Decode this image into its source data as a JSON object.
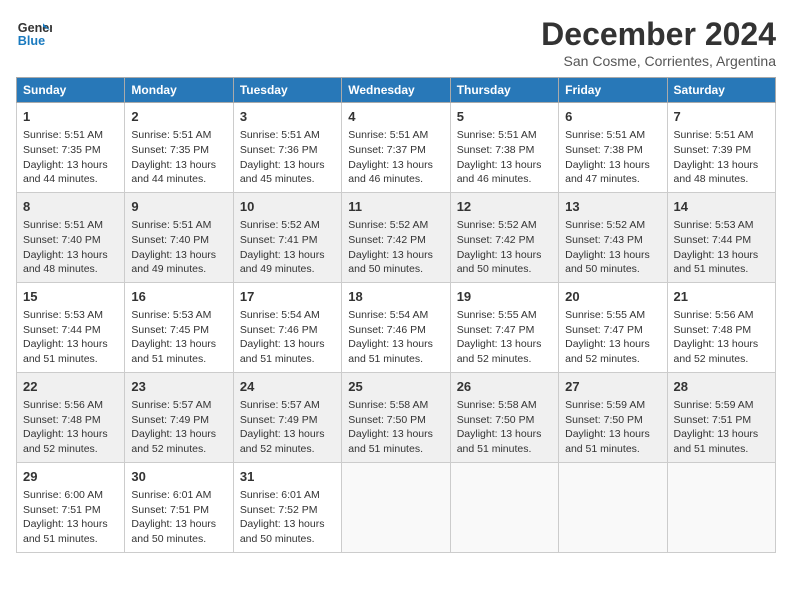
{
  "header": {
    "logo_line1": "General",
    "logo_line2": "Blue",
    "month": "December 2024",
    "location": "San Cosme, Corrientes, Argentina"
  },
  "weekdays": [
    "Sunday",
    "Monday",
    "Tuesday",
    "Wednesday",
    "Thursday",
    "Friday",
    "Saturday"
  ],
  "weeks": [
    [
      {
        "day": 1,
        "lines": [
          "Sunrise: 5:51 AM",
          "Sunset: 7:35 PM",
          "Daylight: 13 hours",
          "and 44 minutes."
        ]
      },
      {
        "day": 2,
        "lines": [
          "Sunrise: 5:51 AM",
          "Sunset: 7:35 PM",
          "Daylight: 13 hours",
          "and 44 minutes."
        ]
      },
      {
        "day": 3,
        "lines": [
          "Sunrise: 5:51 AM",
          "Sunset: 7:36 PM",
          "Daylight: 13 hours",
          "and 45 minutes."
        ]
      },
      {
        "day": 4,
        "lines": [
          "Sunrise: 5:51 AM",
          "Sunset: 7:37 PM",
          "Daylight: 13 hours",
          "and 46 minutes."
        ]
      },
      {
        "day": 5,
        "lines": [
          "Sunrise: 5:51 AM",
          "Sunset: 7:38 PM",
          "Daylight: 13 hours",
          "and 46 minutes."
        ]
      },
      {
        "day": 6,
        "lines": [
          "Sunrise: 5:51 AM",
          "Sunset: 7:38 PM",
          "Daylight: 13 hours",
          "and 47 minutes."
        ]
      },
      {
        "day": 7,
        "lines": [
          "Sunrise: 5:51 AM",
          "Sunset: 7:39 PM",
          "Daylight: 13 hours",
          "and 48 minutes."
        ]
      }
    ],
    [
      {
        "day": 8,
        "lines": [
          "Sunrise: 5:51 AM",
          "Sunset: 7:40 PM",
          "Daylight: 13 hours",
          "and 48 minutes."
        ]
      },
      {
        "day": 9,
        "lines": [
          "Sunrise: 5:51 AM",
          "Sunset: 7:40 PM",
          "Daylight: 13 hours",
          "and 49 minutes."
        ]
      },
      {
        "day": 10,
        "lines": [
          "Sunrise: 5:52 AM",
          "Sunset: 7:41 PM",
          "Daylight: 13 hours",
          "and 49 minutes."
        ]
      },
      {
        "day": 11,
        "lines": [
          "Sunrise: 5:52 AM",
          "Sunset: 7:42 PM",
          "Daylight: 13 hours",
          "and 50 minutes."
        ]
      },
      {
        "day": 12,
        "lines": [
          "Sunrise: 5:52 AM",
          "Sunset: 7:42 PM",
          "Daylight: 13 hours",
          "and 50 minutes."
        ]
      },
      {
        "day": 13,
        "lines": [
          "Sunrise: 5:52 AM",
          "Sunset: 7:43 PM",
          "Daylight: 13 hours",
          "and 50 minutes."
        ]
      },
      {
        "day": 14,
        "lines": [
          "Sunrise: 5:53 AM",
          "Sunset: 7:44 PM",
          "Daylight: 13 hours",
          "and 51 minutes."
        ]
      }
    ],
    [
      {
        "day": 15,
        "lines": [
          "Sunrise: 5:53 AM",
          "Sunset: 7:44 PM",
          "Daylight: 13 hours",
          "and 51 minutes."
        ]
      },
      {
        "day": 16,
        "lines": [
          "Sunrise: 5:53 AM",
          "Sunset: 7:45 PM",
          "Daylight: 13 hours",
          "and 51 minutes."
        ]
      },
      {
        "day": 17,
        "lines": [
          "Sunrise: 5:54 AM",
          "Sunset: 7:46 PM",
          "Daylight: 13 hours",
          "and 51 minutes."
        ]
      },
      {
        "day": 18,
        "lines": [
          "Sunrise: 5:54 AM",
          "Sunset: 7:46 PM",
          "Daylight: 13 hours",
          "and 51 minutes."
        ]
      },
      {
        "day": 19,
        "lines": [
          "Sunrise: 5:55 AM",
          "Sunset: 7:47 PM",
          "Daylight: 13 hours",
          "and 52 minutes."
        ]
      },
      {
        "day": 20,
        "lines": [
          "Sunrise: 5:55 AM",
          "Sunset: 7:47 PM",
          "Daylight: 13 hours",
          "and 52 minutes."
        ]
      },
      {
        "day": 21,
        "lines": [
          "Sunrise: 5:56 AM",
          "Sunset: 7:48 PM",
          "Daylight: 13 hours",
          "and 52 minutes."
        ]
      }
    ],
    [
      {
        "day": 22,
        "lines": [
          "Sunrise: 5:56 AM",
          "Sunset: 7:48 PM",
          "Daylight: 13 hours",
          "and 52 minutes."
        ]
      },
      {
        "day": 23,
        "lines": [
          "Sunrise: 5:57 AM",
          "Sunset: 7:49 PM",
          "Daylight: 13 hours",
          "and 52 minutes."
        ]
      },
      {
        "day": 24,
        "lines": [
          "Sunrise: 5:57 AM",
          "Sunset: 7:49 PM",
          "Daylight: 13 hours",
          "and 52 minutes."
        ]
      },
      {
        "day": 25,
        "lines": [
          "Sunrise: 5:58 AM",
          "Sunset: 7:50 PM",
          "Daylight: 13 hours",
          "and 51 minutes."
        ]
      },
      {
        "day": 26,
        "lines": [
          "Sunrise: 5:58 AM",
          "Sunset: 7:50 PM",
          "Daylight: 13 hours",
          "and 51 minutes."
        ]
      },
      {
        "day": 27,
        "lines": [
          "Sunrise: 5:59 AM",
          "Sunset: 7:50 PM",
          "Daylight: 13 hours",
          "and 51 minutes."
        ]
      },
      {
        "day": 28,
        "lines": [
          "Sunrise: 5:59 AM",
          "Sunset: 7:51 PM",
          "Daylight: 13 hours",
          "and 51 minutes."
        ]
      }
    ],
    [
      {
        "day": 29,
        "lines": [
          "Sunrise: 6:00 AM",
          "Sunset: 7:51 PM",
          "Daylight: 13 hours",
          "and 51 minutes."
        ]
      },
      {
        "day": 30,
        "lines": [
          "Sunrise: 6:01 AM",
          "Sunset: 7:51 PM",
          "Daylight: 13 hours",
          "and 50 minutes."
        ]
      },
      {
        "day": 31,
        "lines": [
          "Sunrise: 6:01 AM",
          "Sunset: 7:52 PM",
          "Daylight: 13 hours",
          "and 50 minutes."
        ]
      },
      null,
      null,
      null,
      null
    ]
  ]
}
